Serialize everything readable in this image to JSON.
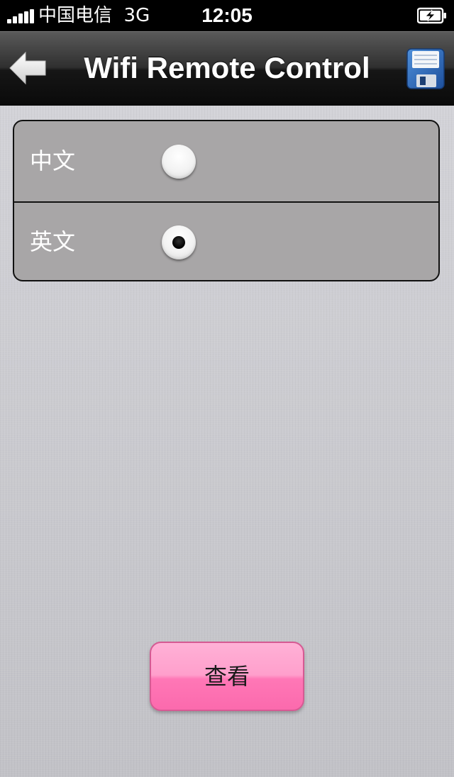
{
  "status_bar": {
    "carrier": "中国电信",
    "network": "3G",
    "time": "12:05"
  },
  "nav": {
    "title": "Wifi Remote Control",
    "back_icon": "back-arrow-icon",
    "save_icon": "floppy-disk-icon"
  },
  "language_options": [
    {
      "label": "中文",
      "selected": false
    },
    {
      "label": "英文",
      "selected": true
    }
  ],
  "view_button": {
    "label": "查看",
    "color": "#ff8fc3"
  },
  "colors": {
    "nav_bar": "#1a1a1a",
    "option_group": "#a8a6a7",
    "background": "#c4c4c9"
  }
}
